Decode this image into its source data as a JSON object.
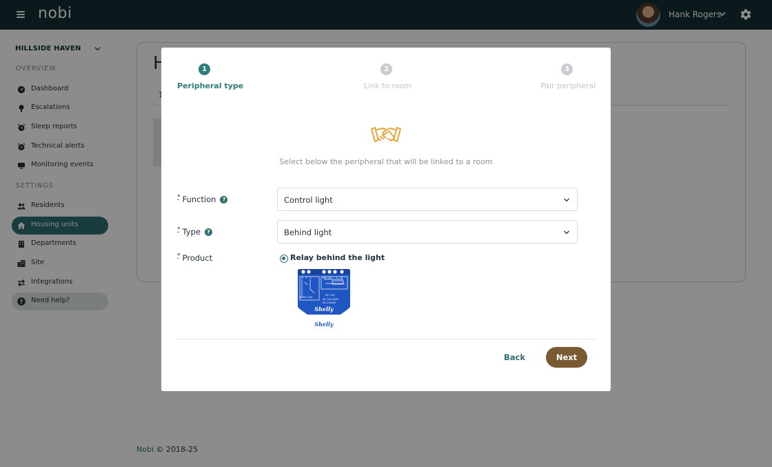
{
  "app": {
    "logo": "nobi",
    "user_name": "Hank Rogers"
  },
  "sidebar": {
    "site_name": "HILLSIDE HAVEN",
    "sections": {
      "overview": "OVERVIEW",
      "settings": "SETTINGS"
    },
    "items": [
      {
        "label": "Dashboard",
        "icon": "dashboard-icon"
      },
      {
        "label": "Escalations",
        "icon": "escalation-icon"
      },
      {
        "label": "Sleep reports",
        "icon": "alarm-clock-icon"
      },
      {
        "label": "Technical alerts",
        "icon": "alarm-clock-icon"
      },
      {
        "label": "Monitoring events",
        "icon": "monitor-icon"
      },
      {
        "label": "Residents",
        "icon": "users-icon"
      },
      {
        "label": "Housing units",
        "icon": "house-icon",
        "active": true
      },
      {
        "label": "Departments",
        "icon": "building-icon"
      },
      {
        "label": "Site",
        "icon": "city-icon"
      },
      {
        "label": "Integrations",
        "icon": "arrows-icon"
      },
      {
        "label": "Need help?",
        "icon": "help-icon"
      }
    ]
  },
  "background": {
    "title_fragment": "H",
    "tab_fragment": "1"
  },
  "footer": {
    "brand": "Nobi",
    "copyright": "© 2018-25"
  },
  "modal": {
    "steps": [
      {
        "number": "1",
        "label": "Peripheral type",
        "state": "active"
      },
      {
        "number": "2",
        "label": "Link to room",
        "state": "inactive"
      },
      {
        "number": "3",
        "label": "Pair peripheral",
        "state": "inactive"
      }
    ],
    "description": "Select below the peripheral that will be linked to a room",
    "required_marker": "*",
    "help_glyph": "?",
    "function": {
      "label": "Function",
      "value": "Control light"
    },
    "type": {
      "label": "Type",
      "value": "Behind light"
    },
    "product": {
      "label": "Product",
      "option": "Relay behind the light",
      "brand": "Shelly"
    },
    "back_label": "Back",
    "next_label": "Next"
  },
  "colors": {
    "topbar": "#122f33",
    "accent": "#2e6e72",
    "next_button": "#7a5b31",
    "highlight": "#f7b684",
    "icon_orange": "#e8a23a"
  }
}
